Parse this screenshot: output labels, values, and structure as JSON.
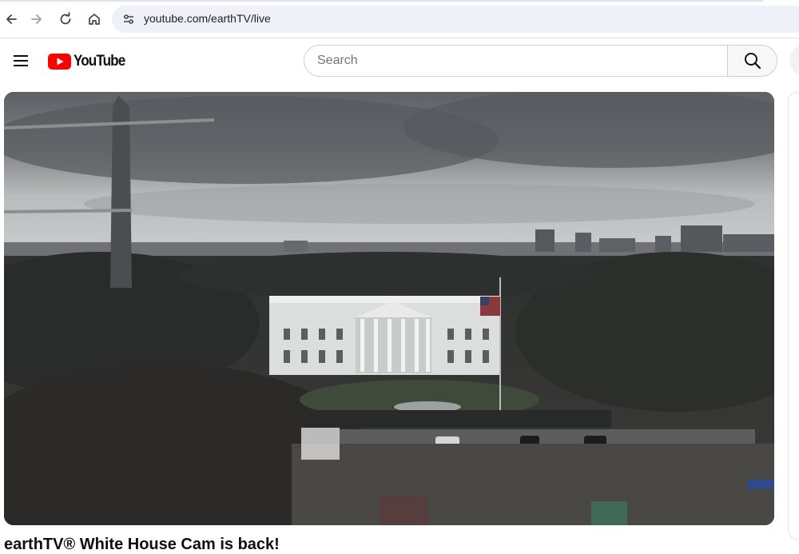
{
  "browser": {
    "url": "youtube.com/earthTV/live",
    "icons": [
      "back-arrow-icon",
      "forward-arrow-icon",
      "reload-icon",
      "home-icon",
      "site-settings-icon"
    ]
  },
  "header": {
    "logo_text": "YouTube",
    "search_placeholder": "Search",
    "icons": [
      "hamburger-menu-icon",
      "youtube-play-logo-icon",
      "search-icon"
    ]
  },
  "video": {
    "title": "earthTV® White House Cam is back!",
    "scene": "live-webcam-white-house"
  },
  "colors": {
    "youtube_red": "#ff0000",
    "omnibox_bg": "#eef1f8",
    "text_primary": "#0f0f0f"
  }
}
